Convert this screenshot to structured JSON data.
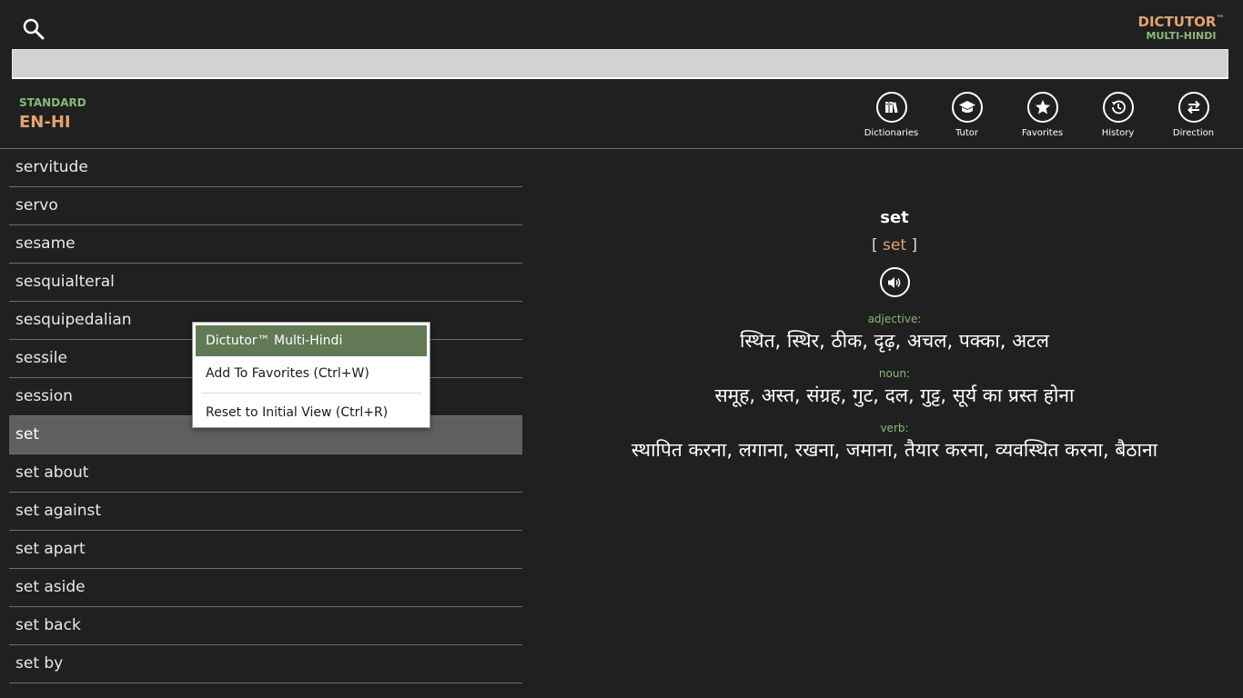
{
  "header": {
    "search_icon": "search-icon",
    "brand": {
      "title": "DICTUTOR",
      "tm": "™",
      "subtitle": "MULTI-HINDI"
    },
    "search_input": {
      "value": "",
      "placeholder": ""
    }
  },
  "mode": {
    "standard": "STANDARD",
    "pair": "EN-HI"
  },
  "toolbar": [
    {
      "label": "Dictionaries",
      "icon": "books-icon"
    },
    {
      "label": "Tutor",
      "icon": "graduation-cap-icon"
    },
    {
      "label": "Favorites",
      "icon": "star-icon"
    },
    {
      "label": "History",
      "icon": "history-clock-icon"
    },
    {
      "label": "Direction",
      "icon": "swap-arrows-icon"
    }
  ],
  "word_list": [
    "servitude",
    "servo",
    "sesame",
    "sesquialteral",
    "sesquipedalian",
    "sessile",
    "session",
    "set",
    "set about",
    "set against",
    "set apart",
    "set aside",
    "set back",
    "set by"
  ],
  "selected_word": "set",
  "entry": {
    "headword": "set",
    "pron_open": "[",
    "pronunciation": "set",
    "pron_close": "]",
    "audio_icon": "speaker-icon",
    "senses": [
      {
        "pos": "adjective:",
        "translation": "स्थित, स्थिर, ठीक, दृढ़, अचल, पक्का, अटल"
      },
      {
        "pos": "noun:",
        "translation": "समूह, अस्त, संग्रह, गुट, दल, गुट्ट, सूर्य का प्रस्त होना"
      },
      {
        "pos": "verb:",
        "translation": "स्थापित करना, लगाना, रखना, जमाना, तैयार करना, व्यवस्थित करना, बैठाना"
      }
    ]
  },
  "context_menu": {
    "items": [
      "Dictutor™ Multi-Hindi",
      "Add To Favorites (Ctrl+W)",
      "Reset to Initial View (Ctrl+R)"
    ]
  },
  "colors": {
    "background": "#202020",
    "accent_orange": "#e3a36f",
    "accent_green": "#89b97a",
    "selected_row": "#5f5f5f",
    "menu_highlight": "#617a55"
  }
}
